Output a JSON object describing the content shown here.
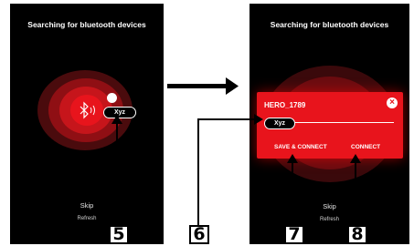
{
  "left_screen": {
    "title": "Searching for bluetooth devices",
    "device_label": "Xyz",
    "skip": "Skip",
    "refresh": "Refresh"
  },
  "right_screen": {
    "title": "Searching for bluetooth devices",
    "dialog": {
      "title": "HERO_1789",
      "name_value": "Xyz",
      "save_connect": "SAVE & CONNECT",
      "connect": "CONNECT"
    },
    "skip": "Skip",
    "refresh": "Refresh"
  },
  "callouts": [
    "5",
    "6",
    "7",
    "8"
  ],
  "colors": {
    "accent": "#e8141c",
    "background": "#000000"
  }
}
